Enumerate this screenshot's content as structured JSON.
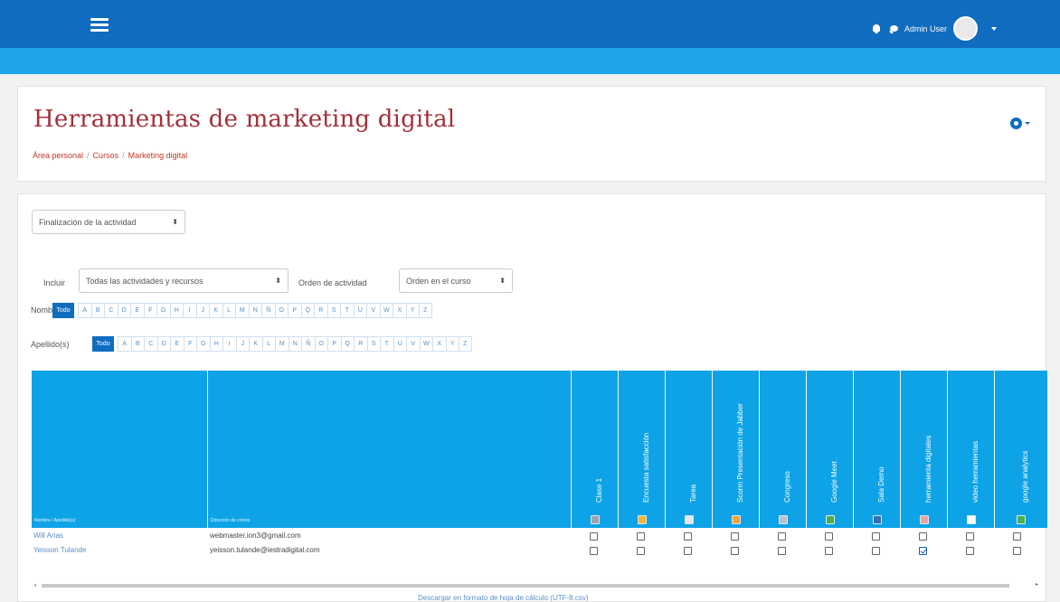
{
  "navbar": {
    "username": "Admin User",
    "colors": {
      "primary": "#0f6cbf",
      "strip": "#1ea4e9"
    }
  },
  "header": {
    "title": "Herramientas de marketing digital",
    "breadcrumb": [
      "Área personal",
      "Cursos",
      "Marketing digital"
    ]
  },
  "report": {
    "report_select": "Finalización de la actividad",
    "include_label": "Incluir",
    "include_value": "Todas las actividades y recursos",
    "order_label": "Orden de actividad",
    "order_value": "Orden en el curso",
    "firstname_label": "Nombre",
    "lastname_label": "Apellido(s)",
    "all_label": "Todo",
    "letters": [
      "A",
      "B",
      "C",
      "D",
      "E",
      "F",
      "G",
      "H",
      "I",
      "J",
      "K",
      "L",
      "M",
      "N",
      "Ñ",
      "O",
      "P",
      "Q",
      "R",
      "S",
      "T",
      "U",
      "V",
      "W",
      "X",
      "Y",
      "Z"
    ]
  },
  "table": {
    "col_name": "Nombre / Apellido(s)",
    "col_email": "Dirección de correo",
    "activities": [
      {
        "label": "Clase 1",
        "icon_color": "#9aa7b3",
        "icon": "page-icon"
      },
      {
        "label": "Encuesta satisfacción",
        "icon_color": "#f2b632",
        "icon": "feedback-icon"
      },
      {
        "label": "Tarea",
        "icon_color": "#e3e8ee",
        "icon": "assign-icon"
      },
      {
        "label": "Scorm Presentación de Jabber",
        "icon_color": "#f0a53a",
        "icon": "scorm-icon"
      },
      {
        "label": "Congreso",
        "icon_color": "#b9c2cc",
        "icon": "folder-icon"
      },
      {
        "label": "Google Meet",
        "icon_color": "#4caf50",
        "icon": "url-icon"
      },
      {
        "label": "Sala Demo",
        "icon_color": "#3a6fb0",
        "icon": "bbb-icon"
      },
      {
        "label": "herramienta digitales",
        "icon_color": "#e9a6a6",
        "icon": "resource-icon"
      },
      {
        "label": "video herramientas",
        "icon_color": "#ffffff",
        "icon": "video-icon"
      },
      {
        "label": "google analytics",
        "icon_color": "#4caf50",
        "icon": "url-icon"
      }
    ],
    "rows": [
      {
        "name": "Will Arias",
        "email": "webmaster.ion3@gmail.com",
        "checks": [
          false,
          false,
          false,
          false,
          false,
          false,
          false,
          false,
          false,
          false
        ]
      },
      {
        "name": "Yeisson Tulande",
        "email": "yeisson.tulande@iestradigital.com",
        "checks": [
          false,
          false,
          false,
          false,
          false,
          false,
          false,
          true,
          false,
          false
        ]
      }
    ]
  },
  "footer": {
    "download_link": "Descargar en formato de hoja de cálculo (UTF-8.csv)"
  }
}
